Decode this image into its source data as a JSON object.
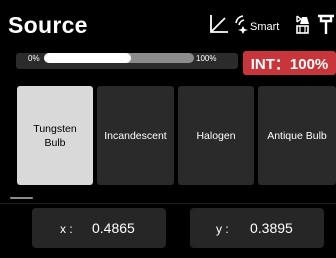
{
  "header": {
    "title": "Source",
    "smart_label": "Smart",
    "icons": [
      "chart-line-icon",
      "smart-sparkle-icon",
      "ble-lamp-icon",
      "hook-icon"
    ]
  },
  "intensity": {
    "min_label": "0%",
    "max_label": "100%",
    "level_fraction": 0.58,
    "badge_text": "INT：100%"
  },
  "sources": [
    {
      "label": "Tungsten\nBulb",
      "selected": true
    },
    {
      "label": "Incandescent",
      "selected": false
    },
    {
      "label": "Halogen",
      "selected": false
    },
    {
      "label": "Antique Bulb",
      "selected": false
    }
  ],
  "coords": {
    "x_label": "x :",
    "x_value": "0.4865",
    "y_label": "y :",
    "y_value": "0.3895"
  },
  "colors": {
    "background": "#000000",
    "int_badge": "#c8363b",
    "tile": "#2a2a2a",
    "tile_selected": "#d9d9d9",
    "coord_box": "#262626"
  }
}
